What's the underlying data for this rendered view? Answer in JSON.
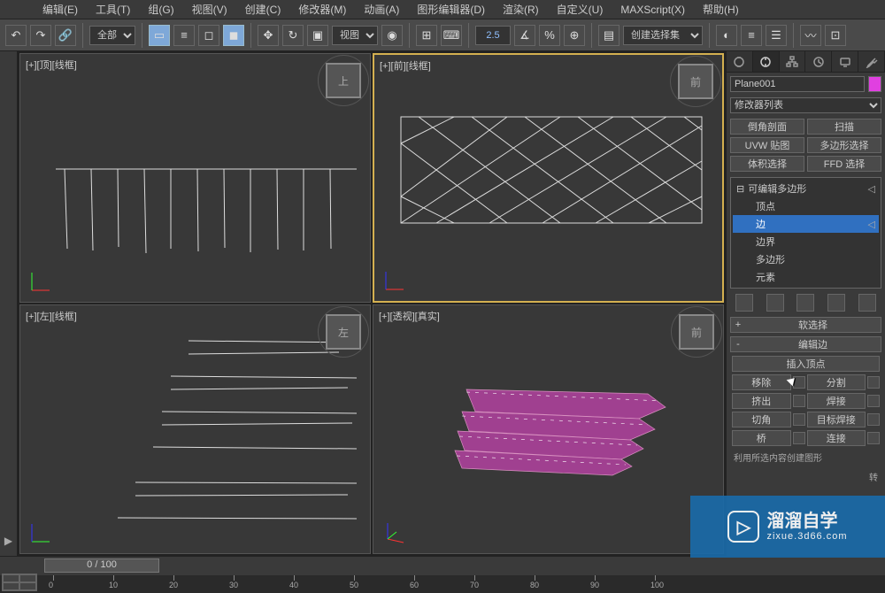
{
  "menu": {
    "items": [
      {
        "label": "编辑(E)"
      },
      {
        "label": "工具(T)"
      },
      {
        "label": "组(G)"
      },
      {
        "label": "视图(V)"
      },
      {
        "label": "创建(C)"
      },
      {
        "label": "修改器(M)"
      },
      {
        "label": "动画(A)"
      },
      {
        "label": "图形编辑器(D)"
      },
      {
        "label": "渲染(R)"
      },
      {
        "label": "自定义(U)"
      },
      {
        "label": "MAXScript(X)"
      },
      {
        "label": "帮助(H)"
      }
    ]
  },
  "toolbar": {
    "selection_filter": "全部",
    "coord_system": "视图",
    "spinner_value": "2.5",
    "named_set": "创建选择集"
  },
  "viewports": {
    "top": {
      "label": "[+][顶][线框]",
      "cube": "上"
    },
    "front": {
      "label": "[+][前][线框]",
      "cube": "前"
    },
    "left": {
      "label": "[+][左][线框]",
      "cube": "左"
    },
    "persp": {
      "label": "[+][透视][真实]",
      "cube": "前"
    }
  },
  "panel": {
    "object_name": "Plane001",
    "modifier_list": "修改器列表",
    "mod_buttons": [
      "倒角剖面",
      "扫描",
      "UVW 贴图",
      "多边形选择",
      "体积选择",
      "FFD 选择"
    ],
    "stack": {
      "root": "可编辑多边形",
      "subs": [
        "顶点",
        "边",
        "边界",
        "多边形",
        "元素"
      ],
      "selected": "边"
    },
    "rollups": {
      "soft_sel": "软选择",
      "edit_edge": {
        "title": "编辑边",
        "insert_vertex": "插入顶点",
        "rows": [
          {
            "a": "移除",
            "b": "分割"
          },
          {
            "a": "挤出",
            "b": "焊接"
          },
          {
            "a": "切角",
            "b": "目标焊接"
          },
          {
            "a": "桥",
            "b": "连接"
          }
        ],
        "create_shape": "利用所选内容创建图形",
        "rotate": "转"
      }
    }
  },
  "timeline": {
    "frame_display": "0 / 100",
    "ticks": [
      0,
      10,
      20,
      30,
      40,
      50,
      60,
      70,
      80,
      90,
      100
    ]
  },
  "watermark": {
    "main": "溜溜自学",
    "sub": "zixue.3d66.com"
  },
  "colors": {
    "accent": "#d4b050",
    "selection": "#3070c0",
    "mesh": "#a04090"
  }
}
